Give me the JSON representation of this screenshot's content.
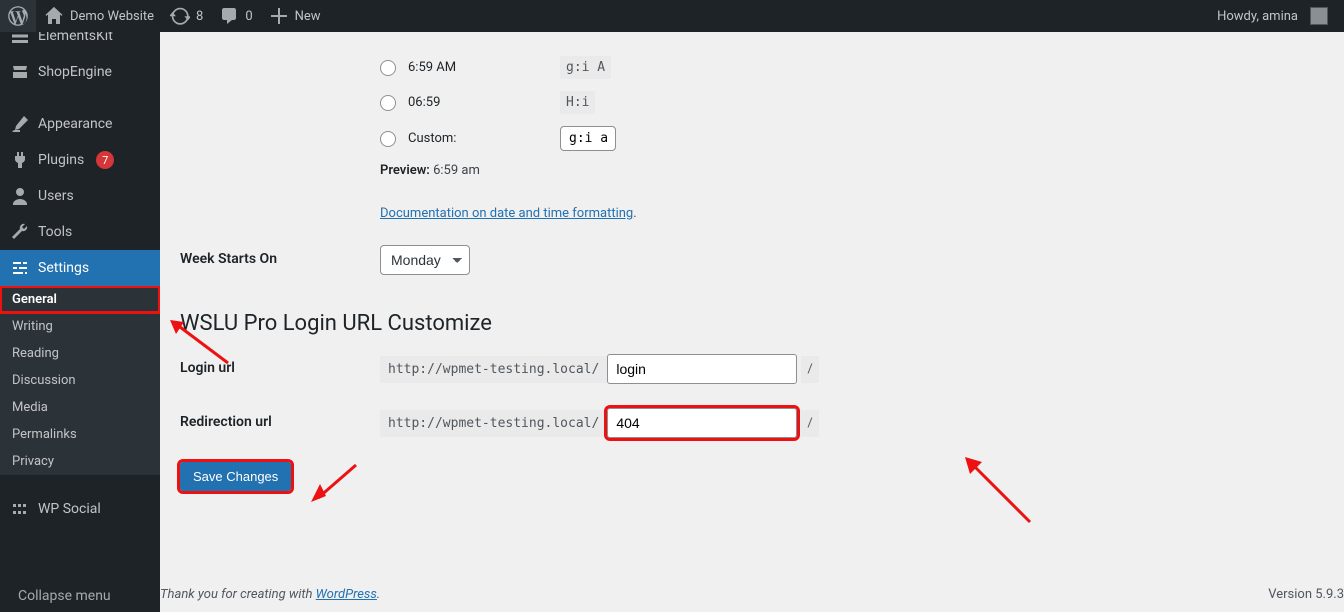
{
  "adminbar": {
    "site_name": "Demo Website",
    "updates_count": "8",
    "comments_count": "0",
    "new_label": "New",
    "howdy": "Howdy, amina"
  },
  "sidebar": {
    "truncated": "ElementsKit",
    "items": [
      {
        "id": "shopengine",
        "label": "ShopEngine"
      },
      {
        "id": "appearance",
        "label": "Appearance"
      },
      {
        "id": "plugins",
        "label": "Plugins",
        "badge": "7"
      },
      {
        "id": "users",
        "label": "Users"
      },
      {
        "id": "tools",
        "label": "Tools"
      },
      {
        "id": "settings",
        "label": "Settings",
        "current": true,
        "sub": [
          {
            "id": "general",
            "label": "General",
            "current": true
          },
          {
            "id": "writing",
            "label": "Writing"
          },
          {
            "id": "reading",
            "label": "Reading"
          },
          {
            "id": "discussion",
            "label": "Discussion"
          },
          {
            "id": "media",
            "label": "Media"
          },
          {
            "id": "permalinks",
            "label": "Permalinks"
          },
          {
            "id": "privacy",
            "label": "Privacy"
          }
        ]
      },
      {
        "id": "wpsocial",
        "label": "WP Social"
      }
    ],
    "collapse_label": "Collapse menu"
  },
  "settings": {
    "time_options": [
      {
        "text": "6:59 AM",
        "code": "g:i A"
      },
      {
        "text": "06:59",
        "code": "H:i"
      },
      {
        "text": "Custom:",
        "input": "g:i a"
      }
    ],
    "preview_label": "Preview:",
    "preview_value": "6:59 am",
    "doc_link": "Documentation on date and time formatting",
    "week_label": "Week Starts On",
    "week_value": "Monday",
    "section_title": "WSLU Pro Login URL Customize",
    "login_label": "Login url",
    "url_prefix": "http://wpmet-testing.local/",
    "login_value": "login",
    "url_suffix": "/",
    "redirect_label": "Redirection url",
    "redirect_value": "404",
    "save_label": "Save Changes"
  },
  "footer": {
    "thanks_prefix": "Thank you for creating with ",
    "thanks_link": "WordPress",
    "thanks_suffix": ".",
    "version": "Version 5.9.3"
  }
}
